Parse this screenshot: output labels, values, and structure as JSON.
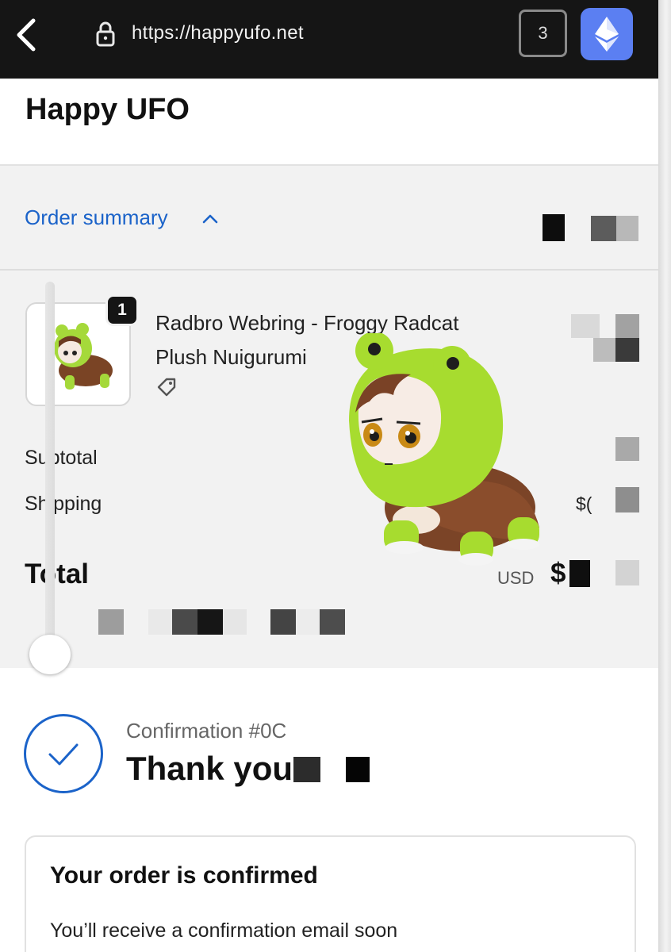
{
  "browser": {
    "url": "https://happyufo.net",
    "tab_count": "3",
    "icons": {
      "back": "back-arrow-icon",
      "lock": "lock-icon",
      "wallet": "ethereum-icon"
    },
    "wallet_color": "#5b7ff2"
  },
  "store": {
    "name": "Happy UFO"
  },
  "order_summary": {
    "toggle_label": "Order summary",
    "accent_color": "#1b63c9",
    "item": {
      "quantity": "1",
      "name_line1": "Radbro Webring - Froggy Radcat",
      "name_line2": "Plush Nuigurumi",
      "tag_icon": "price-tag-icon"
    },
    "subtotal_label": "Subtotal",
    "shipping_label": "Shipping",
    "shipping_value_prefix": "$(",
    "total_label": "Total",
    "currency": "USD",
    "total_value_prefix": "$"
  },
  "confirmation": {
    "number_label": "Confirmation #0C",
    "thanks_text": "Thank you"
  },
  "order_card": {
    "title": "Your order is confirmed",
    "body": "You’ll receive a confirmation email soon"
  }
}
